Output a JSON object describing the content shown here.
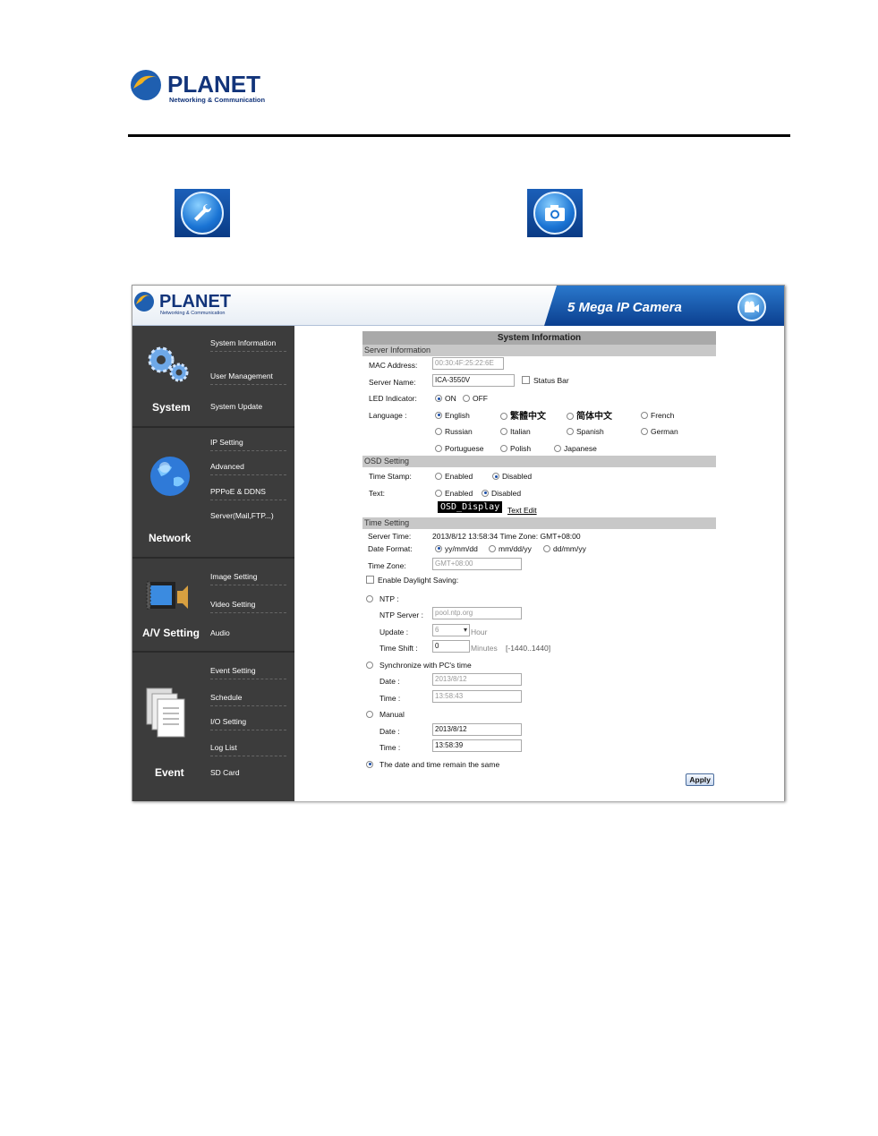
{
  "doc": {
    "logo_text": "PLANET",
    "logo_sub": "Networking & Communication"
  },
  "icons": {
    "wrench": "wrench-icon",
    "camera": "camera-icon"
  },
  "banner": {
    "logo_text": "PLANET",
    "logo_sub": "Networking & Communication",
    "title": "5 Mega IP Camera"
  },
  "sidebar": {
    "groups": [
      {
        "label": "System",
        "items": [
          "System Information",
          "User Management",
          "System Update"
        ]
      },
      {
        "label": "Network",
        "items": [
          "IP Setting",
          "Advanced",
          "PPPoE & DDNS",
          "Server(Mail,FTP...)"
        ]
      },
      {
        "label": "A/V Setting",
        "items": [
          "Image Setting",
          "Video Setting",
          "Audio"
        ]
      },
      {
        "label": "Event",
        "items": [
          "Event Setting",
          "Schedule",
          "I/O Setting",
          "Log List",
          "SD Card"
        ]
      }
    ]
  },
  "page": {
    "title": "System Information",
    "server_info": {
      "heading": "Server Information",
      "mac_label": "MAC Address:",
      "mac_value": "00:30:4F:25:22:6E",
      "name_label": "Server Name:",
      "name_value": "ICA-3550V",
      "status_bar": "Status Bar",
      "led_label": "LED Indicator:",
      "led_on": "ON",
      "led_off": "OFF",
      "lang_label": "Language :",
      "languages": [
        "English",
        "繁體中文",
        "简体中文",
        "French",
        "Russian",
        "Italian",
        "Spanish",
        "German",
        "Portuguese",
        "Polish",
        "Japanese"
      ],
      "selected_language": "English"
    },
    "osd": {
      "heading": "OSD Setting",
      "stamp_label": "Time Stamp:",
      "text_label": "Text:",
      "enabled": "Enabled",
      "disabled": "Disabled",
      "osd_text": "OSD_Display",
      "text_edit": "Text Edit"
    },
    "time": {
      "heading": "Time Setting",
      "server_time_label": "Server Time:",
      "server_time_value": "2013/8/12 13:58:34 Time Zone: GMT+08:00",
      "format_label": "Date Format:",
      "formats": [
        "yy/mm/dd",
        "mm/dd/yy",
        "dd/mm/yy"
      ],
      "zone_label": "Time Zone:",
      "zone_value": "GMT+08:00",
      "daylight": "Enable Daylight Saving:",
      "ntp": "NTP :",
      "ntp_server_label": "NTP Server :",
      "ntp_server_value": "pool.ntp.org",
      "update_label": "Update :",
      "update_value": "6",
      "update_unit": "Hour",
      "shift_label": "Time Shift :",
      "shift_value": "0",
      "shift_unit": "Minutes",
      "shift_range": "[-1440..1440]",
      "sync": "Synchronize with PC's time",
      "date_label": "Date :",
      "time_label": "Time :",
      "sync_date": "2013/8/12",
      "sync_time": "13:58:43",
      "manual": "Manual",
      "manual_date": "2013/8/12",
      "manual_time": "13:58:39",
      "same": "The date and time remain the same"
    },
    "apply": "Apply"
  }
}
